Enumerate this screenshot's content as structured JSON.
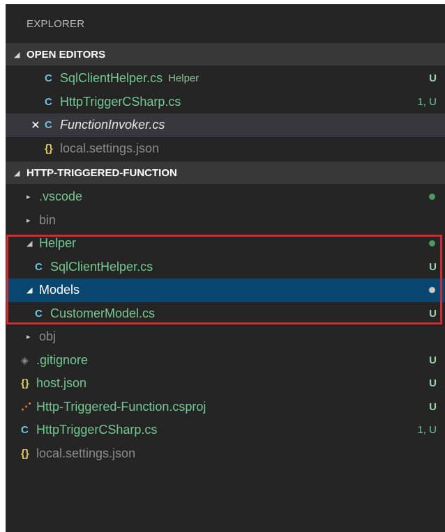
{
  "panel": {
    "title": "EXPLORER"
  },
  "open_editors": {
    "header": "OPEN EDITORS",
    "items": [
      {
        "icon": "C",
        "label": "SqlClientHelper.cs",
        "desc": "Helper",
        "badge": "U"
      },
      {
        "icon": "C",
        "label": "HttpTriggerCSharp.cs",
        "badge": "1, U"
      },
      {
        "icon": "C",
        "label": "FunctionInvoker.cs",
        "close": "✕"
      },
      {
        "icon": "{}",
        "label": "local.settings.json"
      }
    ]
  },
  "project": {
    "header": "HTTP-TRIGGERED-FUNCTION",
    "items": [
      {
        "twist": "▸",
        "label": ".vscode"
      },
      {
        "twist": "▸",
        "label": "bin"
      },
      {
        "twist": "◢",
        "label": "Helper"
      },
      {
        "icon": "C",
        "label": "SqlClientHelper.cs",
        "badge": "U"
      },
      {
        "twist": "◢",
        "label": "Models"
      },
      {
        "icon": "C",
        "label": "CustomerModel.cs",
        "badge": "U"
      },
      {
        "twist": "▸",
        "label": "obj"
      },
      {
        "icon": "◈",
        "label": ".gitignore",
        "badge": "U"
      },
      {
        "icon": "{}",
        "label": "host.json",
        "badge": "U"
      },
      {
        "icon": "⋰",
        "label": "Http-Triggered-Function.csproj",
        "badge": "U"
      },
      {
        "icon": "C",
        "label": "HttpTriggerCSharp.cs",
        "badge": "1, U"
      },
      {
        "icon": "{}",
        "label": "local.settings.json"
      }
    ]
  },
  "colors": {
    "background": "#252526",
    "section_header": "#383838",
    "selected": "#094771",
    "untracked_green": "#73c991",
    "highlight_border": "#d9272e"
  }
}
